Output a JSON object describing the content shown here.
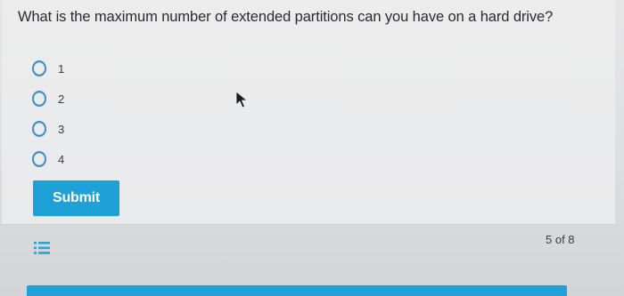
{
  "question": {
    "text": "What is the maximum number of extended partitions can you have on a hard drive?"
  },
  "options": [
    {
      "label": "1",
      "selected": false
    },
    {
      "label": "2",
      "selected": false
    },
    {
      "label": "3",
      "selected": false
    },
    {
      "label": "4",
      "selected": false
    }
  ],
  "actions": {
    "submit_label": "Submit"
  },
  "footer": {
    "progress_label": "5 of 8"
  },
  "colors": {
    "accent": "#1ea1d6",
    "radio_border": "#3b8ec6",
    "text": "#2a2c31"
  },
  "icons": {
    "question_list": "list-icon",
    "pointer": "mouse-cursor-icon"
  }
}
